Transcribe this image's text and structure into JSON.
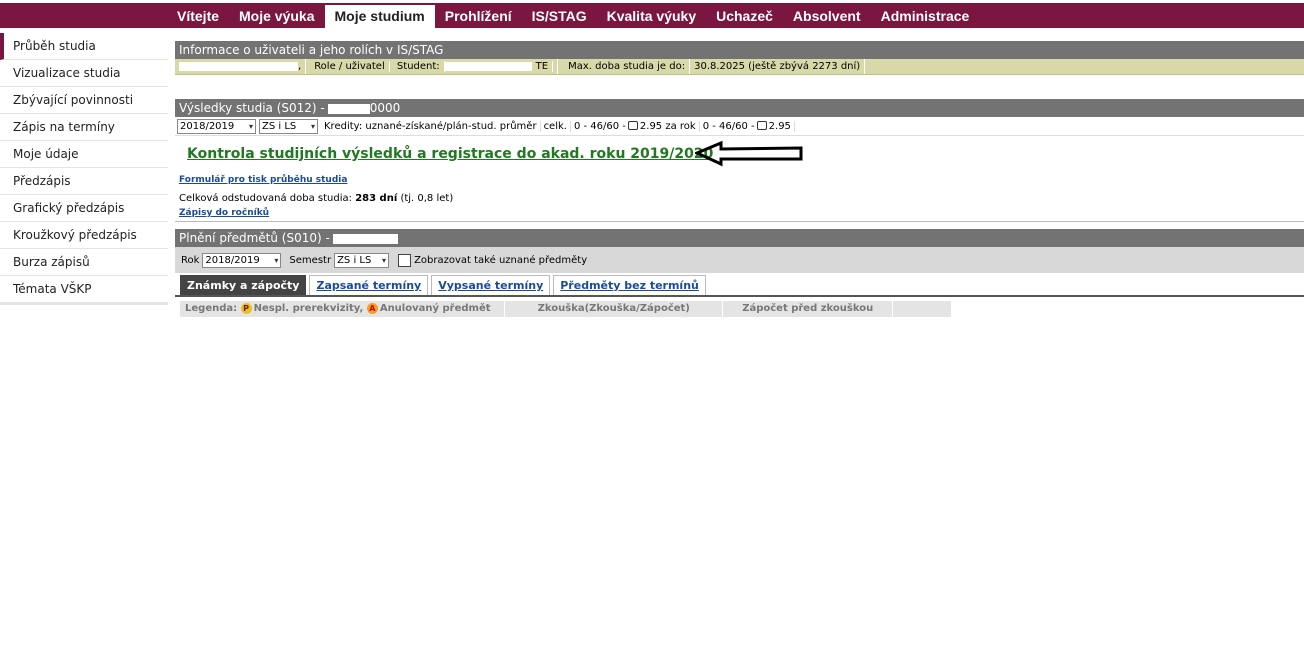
{
  "topnav": [
    "Vítejte",
    "Moje výuka",
    "Moje studium",
    "Prohlížení",
    "IS/STAG",
    "Kvalita výuky",
    "Uchazeč",
    "Absolvent",
    "Administrace"
  ],
  "sidebar": [
    "Průběh studia",
    "Vizualizace studia",
    "Zbývající povinnosti",
    "Zápis na termíny",
    "Moje údaje",
    "Předzápis",
    "Grafický předzápis",
    "Kroužkový předzápis",
    "Burza zápisů",
    "Témata VŠKP"
  ],
  "info": {
    "title": "Informace o uživateli a jeho rolích v IS/STAG",
    "role_label": "Role / uživatel",
    "student_label": "Student:",
    "student_suffix": "TE",
    "max_label": "Max. doba studia je do:",
    "max_value": "30.8.2025 (ještě zbývá 2273 dní)"
  },
  "results": {
    "title": "Výsledky studia (S012) -",
    "title_suffix": "0000",
    "year": "2018/2019",
    "semester": "ZS i LS",
    "credits_label": "Kredity: uznané-získané/plán-stud. průměr",
    "celk_label": "celk.",
    "celk_value": "0 - 46/60 -",
    "celk_avg": "2.95 za rok",
    "year_value": "0 - 46/60 -",
    "year_avg": "2.95",
    "big_link": "Kontrola studijních výsledků a registrace do akad. roku 2019/2020",
    "form_link": "Formulář pro tisk průběhu studia",
    "duration_label": "Celková odstudovaná doba studia:",
    "duration_value": "283 dní",
    "duration_years": "(tj. 0,8 let)",
    "enroll_link": "Zápisy do ročníků"
  },
  "subjects": {
    "title": "Plnění předmětů (S010) -",
    "year_label": "Rok",
    "year": "2018/2019",
    "semester_label": "Semestr",
    "semester": "ZS i LS",
    "checkbox_label": "Zobrazovat také uznané předměty",
    "tabs": [
      "Známky a zápočty",
      "Zapsané termíny",
      "Vypsané termíny",
      "Předměty bez termínů"
    ],
    "legend_label": "Legenda:",
    "legend_p": "Nespl. prerekvizity,",
    "legend_a": "Anulovaný předmět",
    "col_exam": "Zkouška(Zkouška/Zápočet)",
    "col_credit": "Zápočet před zkouškou"
  },
  "icons": {
    "prereq": "P",
    "annulled": "A"
  },
  "colors": {
    "brand": "#7b1640",
    "link_green": "#1f7a1f",
    "link_blue": "#1a4b9a"
  }
}
